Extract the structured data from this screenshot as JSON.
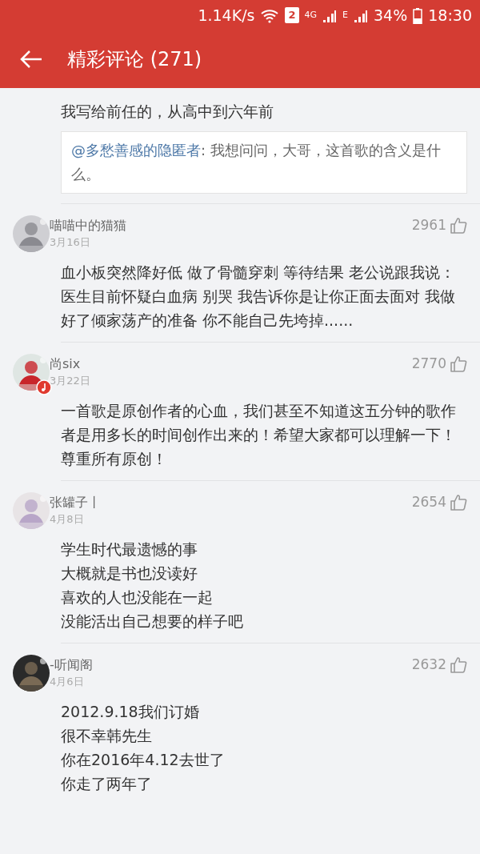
{
  "status_bar": {
    "speed": "1.14K/s",
    "sim": "2",
    "network": "4G",
    "network2": "E",
    "battery": "34%",
    "time": "18:30"
  },
  "header": {
    "title": "精彩评论 (271)"
  },
  "comments": [
    {
      "kind": "partial",
      "lines": [
        "我写给前任的，从高中到六年前"
      ],
      "reply": {
        "user": "@多愁善感的隐匿者",
        "text": ": 我想问问，大哥，这首歌的含义是什么。"
      }
    },
    {
      "kind": "full",
      "name": "喵喵中的猫猫",
      "date": "3月16日",
      "likes": "2961",
      "badge": false,
      "lines": [
        "血小板突然降好低 做了骨髓穿刺 等待结果 老公说跟我说：医生目前怀疑白血病 别哭 我告诉你是让你正面去面对 我做好了倾家荡产的准备 你不能自己先垮掉......"
      ]
    },
    {
      "kind": "full",
      "name": "尚six",
      "date": "3月22日",
      "likes": "2770",
      "badge": true,
      "lines": [
        "一首歌是原创作者的心血，我们甚至不知道这五分钟的歌作者是用多长的时间创作出来的！希望大家都可以理解一下！尊重所有原创！"
      ]
    },
    {
      "kind": "full",
      "name": "张罐子丨",
      "date": "4月8日",
      "likes": "2654",
      "badge": false,
      "lines": [
        "学生时代最遗憾的事",
        "大概就是书也没读好",
        "喜欢的人也没能在一起",
        "没能活出自己想要的样子吧"
      ]
    },
    {
      "kind": "full",
      "name": "-听闻阁",
      "date": "4月6日",
      "likes": "2632",
      "badge": false,
      "lines": [
        "2012.9.18我们订婚",
        "很不幸韩先生",
        "你在2016年4.12去世了",
        "你走了两年了"
      ]
    }
  ]
}
